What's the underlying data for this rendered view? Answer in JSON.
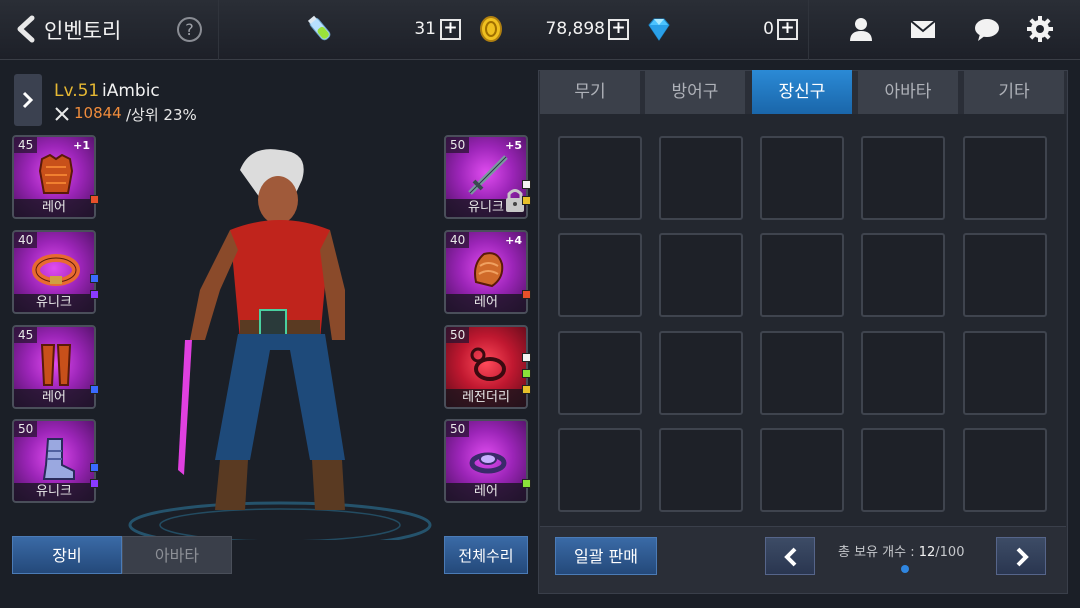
{
  "header": {
    "title": "인벤토리",
    "help_symbol": "?",
    "resources": [
      {
        "icon": "stamina-potion-icon",
        "value": "31"
      },
      {
        "icon": "gold-coin-icon",
        "value": "78,898"
      },
      {
        "icon": "diamond-gem-icon",
        "value": "0"
      }
    ],
    "plus_symbol": "+",
    "buttons": [
      "friends-icon",
      "mail-icon",
      "chat-icon",
      "settings-icon"
    ]
  },
  "character": {
    "level": "Lv.51",
    "name": "iAmbic",
    "power": "10844",
    "rank": "/상위 23%"
  },
  "left_slots": [
    {
      "level": "45",
      "plus": "+1",
      "grade": "레어",
      "color": "purple",
      "icon": "armor-chest-icon"
    },
    {
      "level": "40",
      "plus": "",
      "grade": "유니크",
      "color": "purple",
      "icon": "belt-icon"
    },
    {
      "level": "45",
      "plus": "",
      "grade": "레어",
      "color": "purple",
      "icon": "leg-armor-icon"
    },
    {
      "level": "50",
      "plus": "",
      "grade": "유니크",
      "color": "purple",
      "icon": "boots-icon"
    }
  ],
  "right_slots": [
    {
      "level": "50",
      "plus": "+5",
      "grade": "유니크",
      "color": "purple",
      "icon": "sword-icon"
    },
    {
      "level": "40",
      "plus": "+4",
      "grade": "레어",
      "color": "purple",
      "icon": "gauntlet-icon"
    },
    {
      "level": "50",
      "plus": "",
      "grade": "레전더리",
      "color": "red",
      "icon": "necklace-icon"
    },
    {
      "level": "50",
      "plus": "",
      "grade": "레어",
      "color": "purple",
      "icon": "ring-icon"
    }
  ],
  "left_buttons": {
    "equip": "장비",
    "avatar": "아바타",
    "repair_all": "전체수리"
  },
  "tabs": [
    {
      "label": "무기",
      "active": false
    },
    {
      "label": "방어구",
      "active": false
    },
    {
      "label": "장신구",
      "active": true
    },
    {
      "label": "아바타",
      "active": false
    },
    {
      "label": "기타",
      "active": false
    }
  ],
  "footer": {
    "bulk_sell": "일괄 판매",
    "count_label": "총 보유 개수 : ",
    "count_current": "12",
    "count_max": "/100"
  },
  "colors": {
    "accent": "#2b8ad6",
    "gold": "#e6b833",
    "power": "#f08c3c"
  }
}
